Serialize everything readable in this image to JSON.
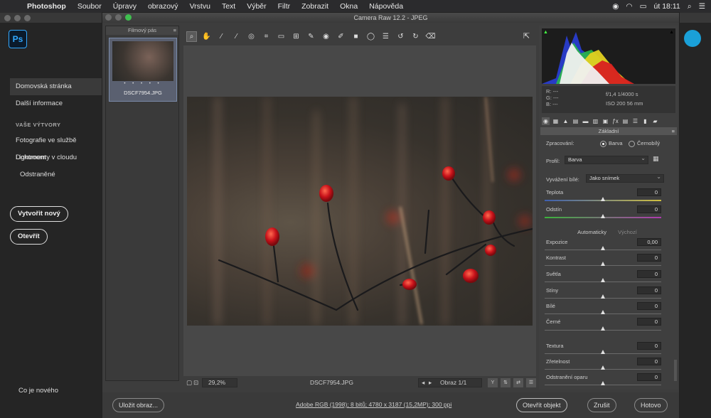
{
  "menubar": {
    "app": "Photoshop",
    "items": [
      "Soubor",
      "Úpravy",
      "obrazový",
      "Vrstvu",
      "Text",
      "Výběr",
      "Filtr",
      "Zobrazit",
      "Okna",
      "Nápověda"
    ],
    "time": "út 18:11"
  },
  "ps_home": {
    "logo": "Ps",
    "nav": {
      "home": "Domovská stránka",
      "more": "Další informace",
      "section": "VAŠE VÝTVORY",
      "lightroom": "Fotografie ve službě Lightroom",
      "cloud_docs": "Dokumenty v cloudu",
      "deleted": "Odstraněné"
    },
    "create_new": "Vytvořit nový",
    "open": "Otevřít",
    "whats_new": "Co je nového"
  },
  "acr": {
    "title": "Camera Raw 12.2 - JPEG",
    "filmstrip": {
      "title": "Filmový pás",
      "stars": "• • • • •",
      "filename": "DSCF7954.JPG"
    },
    "status": {
      "zoom": "29,2%",
      "filename": "DSCF7954.JPG",
      "image_counter": "Obraz 1/1"
    },
    "bottom": {
      "save": "Uložit obraz...",
      "workflow": "Adobe RGB (1998); 8 bitů; 4780 x 3187 (15,2MP); 300 ppi",
      "open_object": "Otevřít objekt",
      "cancel": "Zrušit",
      "done": "Hotovo"
    },
    "info": {
      "r": "R:  ---",
      "g": "G:  ---",
      "b": "B:  ---",
      "exif_line1": "f/1,4    1/4000 s",
      "exif_line2": "ISO 200    56 mm"
    },
    "basic": {
      "section": "Základní",
      "processing_label": "Zpracování:",
      "color": "Barva",
      "bw": "Černobílý",
      "profile_label": "Profil:",
      "profile_value": "Barva",
      "wb_label": "Vyvážení bílé:",
      "wb_value": "Jako snímek",
      "auto": "Automaticky",
      "default": "Výchozí",
      "sliders": [
        {
          "label": "Teplota",
          "value": "0",
          "pos": 0.5
        },
        {
          "label": "Odstín",
          "value": "0",
          "pos": 0.5
        },
        {
          "label": "Expozice",
          "value": "0,00",
          "pos": 0.5
        },
        {
          "label": "Kontrast",
          "value": "0",
          "pos": 0.5
        },
        {
          "label": "Světla",
          "value": "0",
          "pos": 0.5
        },
        {
          "label": "Stíny",
          "value": "0",
          "pos": 0.5
        },
        {
          "label": "Bílé",
          "value": "0",
          "pos": 0.5
        },
        {
          "label": "Černé",
          "value": "0",
          "pos": 0.5
        },
        {
          "label": "Textura",
          "value": "0",
          "pos": 0.5
        },
        {
          "label": "Zřetelnost",
          "value": "0",
          "pos": 0.5
        },
        {
          "label": "Odstranění oparu",
          "value": "0",
          "pos": 0.5
        }
      ]
    }
  }
}
